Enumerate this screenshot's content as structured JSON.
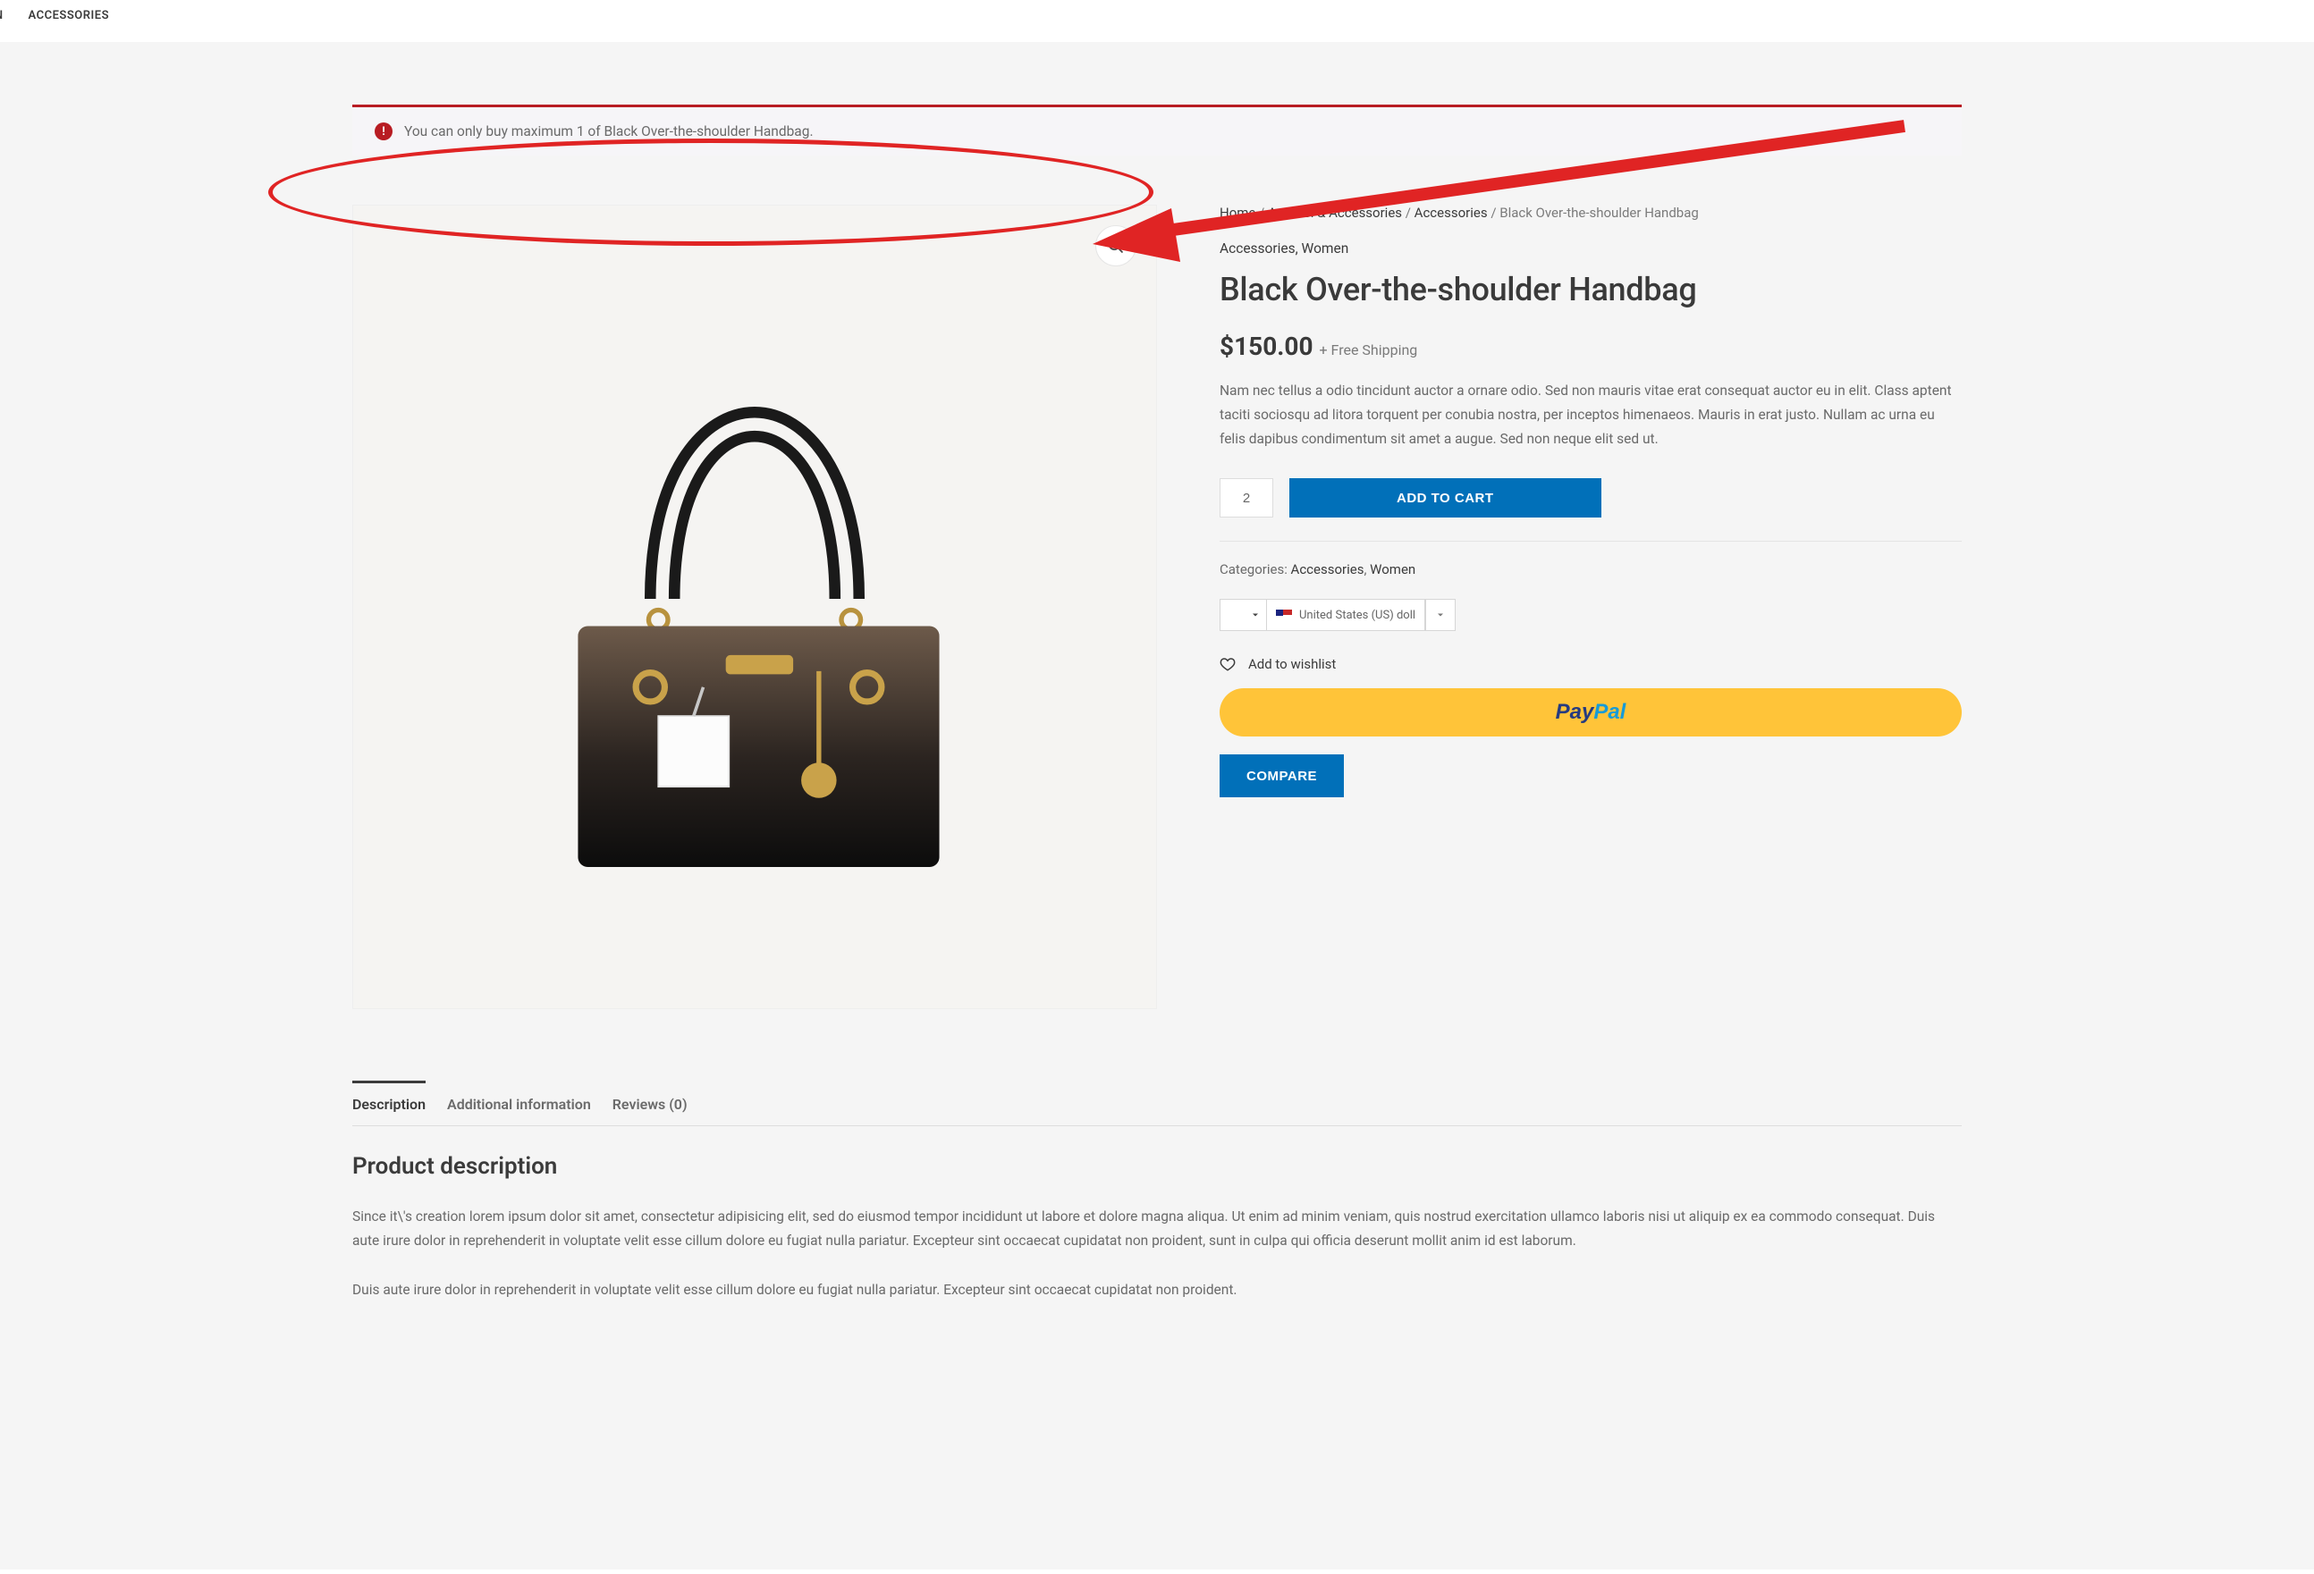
{
  "nav": {
    "accessories": "ACCESSORIES",
    "en_frag": "EN"
  },
  "notice": {
    "text": "You can only buy maximum 1 of Black Over-the-shoulder Handbag."
  },
  "breadcrumb": {
    "home": "Home",
    "cat1": "Apparel & Accessories",
    "cat2": "Accessories",
    "current": "Black Over-the-shoulder Handbag"
  },
  "cat_links": {
    "cat1": "Accessories",
    "cat2": "Women"
  },
  "product": {
    "title": "Black Over-the-shoulder Handbag",
    "currency": "$",
    "price": "150.00",
    "shipping_note": "+ Free Shipping",
    "short_desc": "Nam nec tellus a odio tincidunt auctor a ornare odio. Sed non mauris vitae erat consequat auctor eu in elit. Class aptent taciti sociosqu ad litora torquent per conubia nostra, per inceptos himenaeos. Mauris in erat justo. Nullam ac urna eu felis dapibus condimentum sit amet a augue. Sed non neque elit sed ut.",
    "qty": "2",
    "add_to_cart": "ADD TO CART",
    "categories_label": "Categories: ",
    "meta_cat1": "Accessories",
    "meta_cat2": "Women",
    "currency_selector": "United States (US) doll",
    "wishlist": "Add to wishlist",
    "paypal_pay": "Pay",
    "paypal_pal": "Pal",
    "compare": "COMPARE"
  },
  "tabs": {
    "description": "Description",
    "additional": "Additional information",
    "reviews": "Reviews (0)"
  },
  "desc_panel": {
    "heading": "Product description",
    "p1": "Since it\\'s creation lorem ipsum dolor sit amet, consectetur adipisicing elit, sed do eiusmod tempor incididunt ut labore et dolore magna aliqua. Ut enim ad minim veniam, quis nostrud exercitation ullamco laboris nisi ut aliquip ex ea commodo consequat. Duis aute irure dolor in reprehenderit in voluptate velit esse cillum dolore eu fugiat nulla pariatur. Excepteur sint occaecat cupidatat non proident, sunt in culpa qui officia deserunt mollit anim id est laborum.",
    "p2": "Duis aute irure dolor in reprehenderit in voluptate velit esse cillum dolore eu fugiat nulla pariatur. Excepteur sint occaecat cupidatat non proident."
  }
}
